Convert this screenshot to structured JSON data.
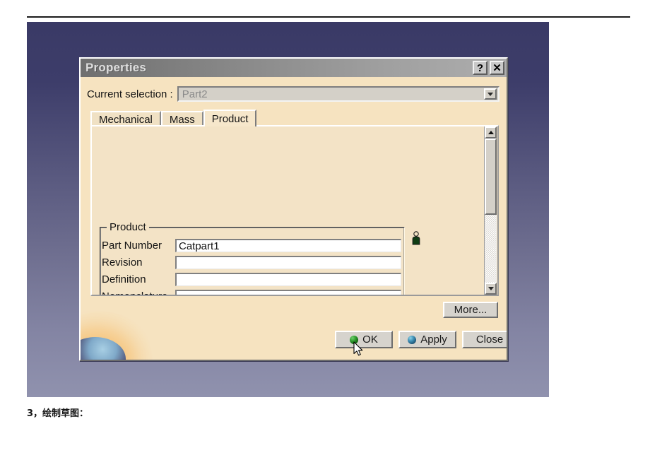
{
  "document": {
    "caption": "3，绘制草图："
  },
  "dialog": {
    "title": "Properties",
    "titlebar_buttons": [
      {
        "name": "help-button",
        "glyph": "?"
      },
      {
        "name": "close-button",
        "glyph": "✕"
      }
    ],
    "selection": {
      "label": "Current selection :",
      "value": "Part2",
      "disabled": true
    },
    "tabs": [
      {
        "label": "Mechanical",
        "active": false
      },
      {
        "label": "Mass",
        "active": false
      },
      {
        "label": "Product",
        "active": true
      }
    ],
    "group": {
      "title": "Product",
      "fields": [
        {
          "label": "Part Number",
          "value": "Catpart1"
        },
        {
          "label": "Revision",
          "value": ""
        },
        {
          "label": "Definition",
          "value": ""
        },
        {
          "label": "Nomenclature",
          "value": ""
        }
      ]
    },
    "scrollbar": {
      "up_arrow": "▲",
      "down_arrow": "▼"
    },
    "buttons": {
      "more": "More...",
      "ok": "OK",
      "apply": "Apply",
      "close": "Close"
    }
  },
  "colors": {
    "desktop_top": "#3a3a66",
    "desktop_bottom": "#9092ae",
    "dialog_face": "#f6e3c0",
    "panel_face": "#f3e3c6",
    "titlebar_left": "#6f6f6f",
    "titlebar_right": "#adadad",
    "ok_sphere": "#2f9c2f",
    "apply_sphere": "#3f8fb5"
  }
}
